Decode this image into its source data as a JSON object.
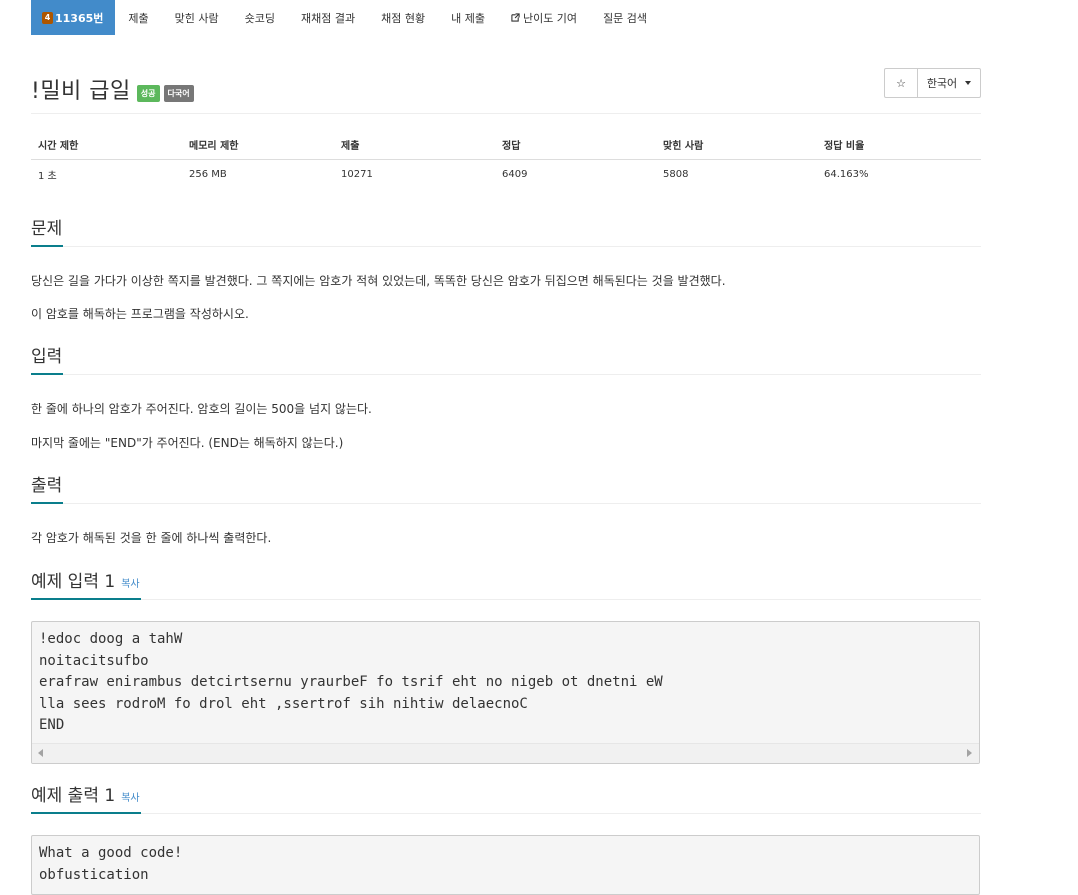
{
  "nav": {
    "problem_number": "11365번",
    "tier_badge": "4",
    "items": [
      "제출",
      "맞힌 사람",
      "숏코딩",
      "재채점 결과",
      "채점 현황",
      "내 제출",
      "난이도 기여",
      "질문 검색"
    ]
  },
  "problem": {
    "title": "!밀비 급일",
    "badges": {
      "success": "성공",
      "multilang": "다국어"
    },
    "star_icon": "☆",
    "language": "한국어"
  },
  "info": {
    "headers": [
      "시간 제한",
      "메모리 제한",
      "제출",
      "정답",
      "맞힌 사람",
      "정답 비율"
    ],
    "values": [
      "1 초",
      "256 MB",
      "10271",
      "6409",
      "5808",
      "64.163%"
    ]
  },
  "sections": {
    "description": {
      "title": "문제",
      "paragraphs": [
        "당신은 길을 가다가 이상한 쪽지를 발견했다. 그 쪽지에는 암호가 적혀 있었는데, 똑똑한 당신은 암호가 뒤집으면 해독된다는 것을 발견했다.",
        "이 암호를 해독하는 프로그램을 작성하시오."
      ]
    },
    "input": {
      "title": "입력",
      "paragraphs": [
        "한 줄에 하나의 암호가 주어진다. 암호의 길이는 500을 넘지 않는다.",
        "마지막 줄에는 \"END\"가 주어진다. (END는 해독하지 않는다.)"
      ]
    },
    "output": {
      "title": "출력",
      "paragraphs": [
        "각 암호가 해독된 것을 한 줄에 하나씩 출력한다."
      ]
    },
    "sample_input": {
      "title": "예제 입력 1",
      "copy": "복사",
      "lines": [
        "!edoc doog a tahW",
        "noitacitsufbo",
        "erafraw enirambus detcirtsernu yraurbeF fo tsrif eht no nigeb ot dnetni eW",
        "lla sees rodroM fo drol eht ,ssertrof sih nihtiw delaecnoC",
        "END"
      ]
    },
    "sample_output": {
      "title": "예제 출력 1",
      "copy": "복사",
      "lines": [
        "What a good code!",
        "obfustication"
      ]
    }
  },
  "colors": {
    "nav_active": "#428bca",
    "tier_bronze": "#ad5600",
    "badge_success": "#5cb85c",
    "badge_multilang": "#777777",
    "section_underline": "#0a7e8c",
    "link": "#428bca"
  }
}
